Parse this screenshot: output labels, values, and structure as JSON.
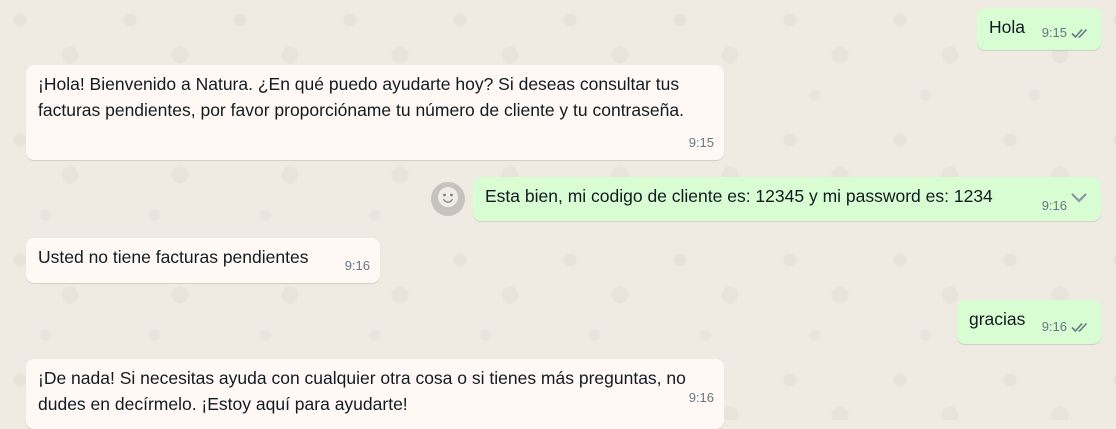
{
  "chat": {
    "messages": [
      {
        "id": "m1",
        "direction": "outgoing",
        "text": "Hola",
        "time": "9:15",
        "status": "read"
      },
      {
        "id": "m2",
        "direction": "incoming",
        "text": "¡Hola! Bienvenido a Natura. ¿En qué puedo ayudarte hoy? Si deseas consultar tus facturas pendientes, por favor proporcióname tu número de cliente y tu contraseña.",
        "time": "9:15"
      },
      {
        "id": "m3",
        "direction": "outgoing",
        "text": "Esta bien, mi codigo de cliente es: 12345 y mi password es: 1234",
        "time": "9:16"
      },
      {
        "id": "m4",
        "direction": "incoming",
        "text": "Usted no tiene facturas pendientes",
        "time": "9:16"
      },
      {
        "id": "m5",
        "direction": "outgoing",
        "text": "gracias",
        "time": "9:16",
        "status": "read"
      },
      {
        "id": "m6",
        "direction": "incoming",
        "text": "¡De nada! Si necesitas ayuda con cualquier otra cosa o si tienes más preguntas, no dudes en decírmelo. ¡Estoy aquí para ayudarte!",
        "time": "9:16"
      }
    ]
  },
  "icons": {
    "read_receipt": "double-check-icon",
    "react": "smiley-icon",
    "menu": "chevron-down-icon"
  },
  "colors": {
    "background": "#efeae2",
    "incoming_bubble": "#fff8f5",
    "outgoing_bubble": "#d9fdd3",
    "meta_text": "#667781",
    "read_tick": "#667781"
  }
}
